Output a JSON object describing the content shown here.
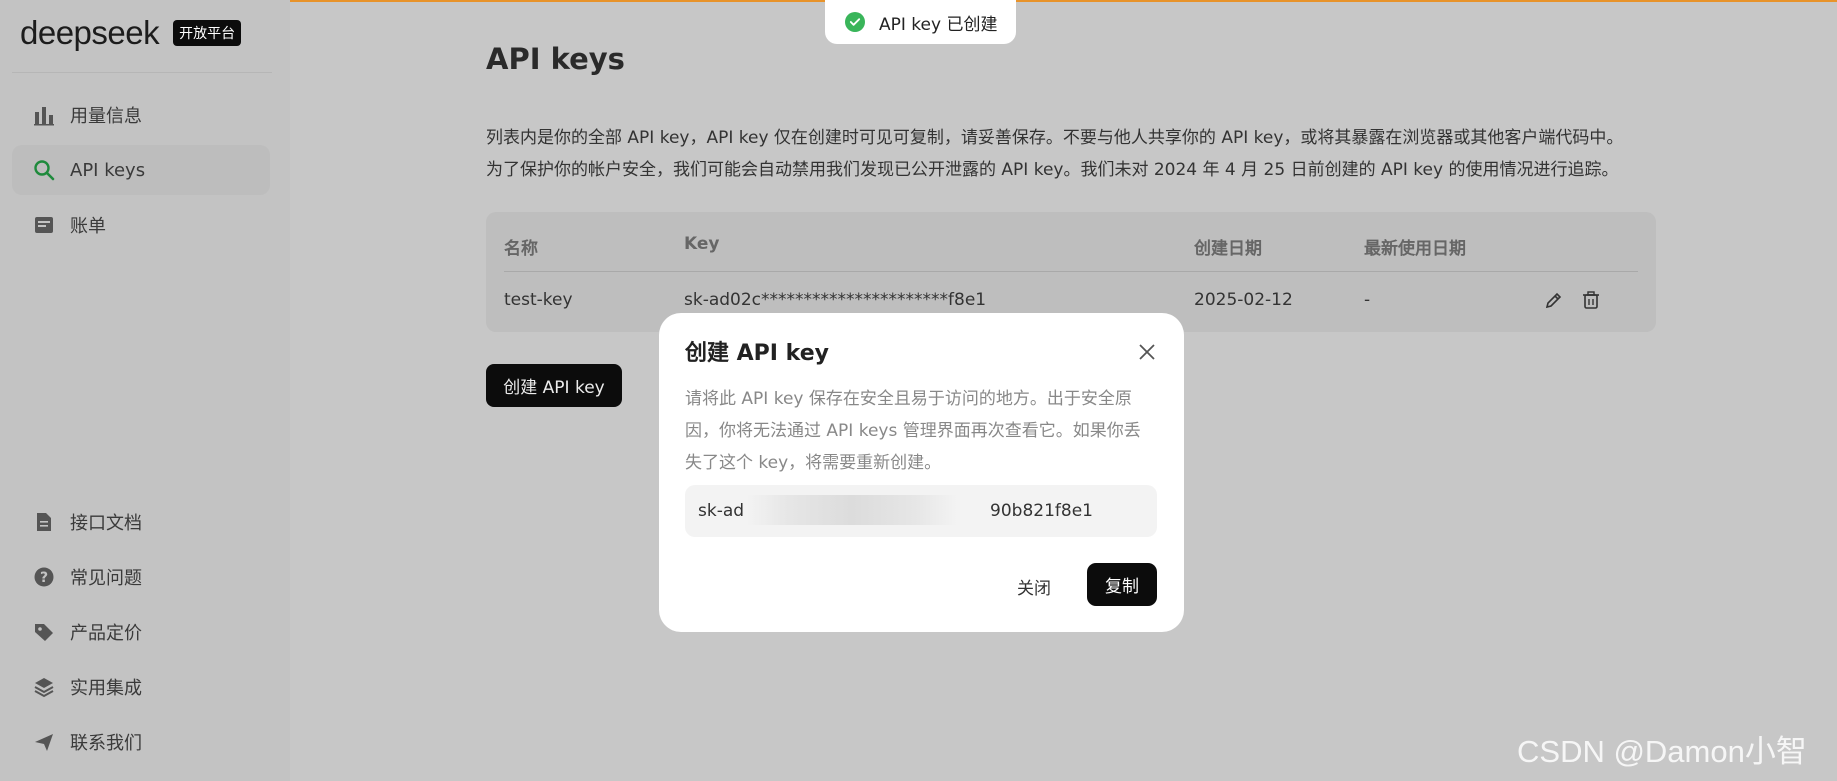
{
  "brand": {
    "name": "deepseek",
    "badge": "开放平台"
  },
  "sidebar": {
    "top_items": [
      {
        "label": "用量信息",
        "icon": "bar-chart-icon"
      },
      {
        "label": "API keys",
        "icon": "search-icon",
        "active": true
      },
      {
        "label": "账单",
        "icon": "bill-icon"
      }
    ],
    "bottom_items": [
      {
        "label": "接口文档",
        "icon": "document-icon"
      },
      {
        "label": "常见问题",
        "icon": "question-icon"
      },
      {
        "label": "产品定价",
        "icon": "tag-icon"
      },
      {
        "label": "实用集成",
        "icon": "layers-icon"
      },
      {
        "label": "联系我们",
        "icon": "send-icon"
      }
    ]
  },
  "main": {
    "title": "API keys",
    "description_line1": "列表内是你的全部 API key，API key 仅在创建时可见可复制，请妥善保存。不要与他人共享你的 API key，或将其暴露在浏览器或其他客户端代码中。",
    "description_line2": "为了保护你的帐户安全，我们可能会自动禁用我们发现已公开泄露的 API key。我们未对 2024 年 4 月 25 日前创建的 API key 的使用情况进行追踪。",
    "table": {
      "headers": {
        "name": "名称",
        "key": "Key",
        "created": "创建日期",
        "last_used": "最新使用日期"
      },
      "rows": [
        {
          "name": "test-key",
          "key": "sk-ad02c**********************f8e1",
          "created": "2025-02-12",
          "last_used": "-"
        }
      ]
    },
    "create_button": "创建 API key"
  },
  "toast": {
    "text": "API key 已创建",
    "color": "#39b55a"
  },
  "modal": {
    "title": "创建 API key",
    "description": "请将此 API key 保存在安全且易于访问的地方。出于安全原因，你将无法通过 API keys 管理界面再次查看它。如果你丢失了这个 key，将需要重新创建。",
    "key_prefix": "sk-ad",
    "key_suffix": "90b821f8e1",
    "close_label": "关闭",
    "copy_label": "复制"
  },
  "watermark": "CSDN @Damon小智",
  "colors": {
    "accent_line": "#e8932a",
    "active_icon": "#1f8a3c",
    "primary_button": "#0c0c0c"
  }
}
